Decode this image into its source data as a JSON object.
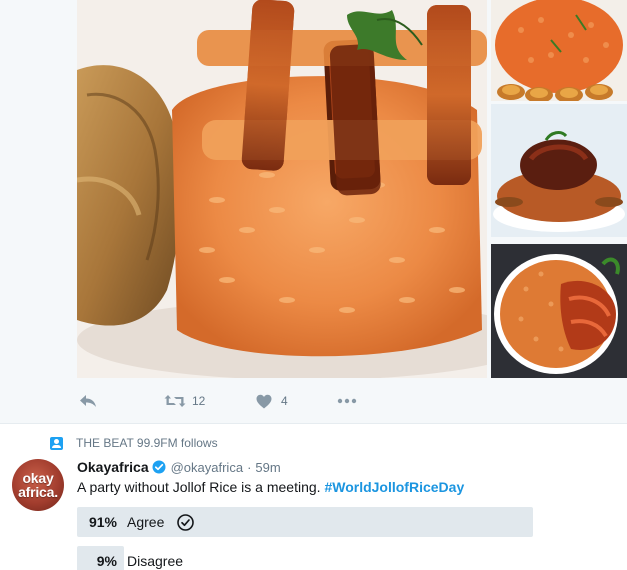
{
  "media": {
    "images": [
      {
        "name": "jollof-rice-plantain-photo"
      },
      {
        "name": "jollof-rice-platter-photo"
      },
      {
        "name": "jollof-rice-meat-photo"
      },
      {
        "name": "jollof-rice-chicken-photo"
      }
    ]
  },
  "actions": {
    "reply_icon": "reply-icon",
    "retweet_icon": "retweet-icon",
    "retweet_count": "12",
    "like_icon": "heart-icon",
    "like_count": "4",
    "more_icon": "more-icon"
  },
  "context": {
    "icon": "follow-icon",
    "text": "THE BEAT 99.9FM follows"
  },
  "tweet": {
    "avatar_text_line1": "okay",
    "avatar_text_line2": "africa.",
    "name": "Okayafrica",
    "handle": "@okayafrica",
    "separator": "·",
    "time": "59m",
    "text": "A party without Jollof Rice is a meeting.",
    "hashtag": "#WorldJollofRiceDay"
  },
  "poll": {
    "options": [
      {
        "percent": "91%",
        "label": "Agree",
        "share": 0.91,
        "chosen": true
      },
      {
        "percent": "9%",
        "label": "Disagree",
        "share": 0.09,
        "chosen": false
      }
    ]
  },
  "colors": {
    "accent": "#1da1f2",
    "hashtag": "#1b95e0",
    "muted": "#657786",
    "poll_bar": "#e1e8ed"
  }
}
